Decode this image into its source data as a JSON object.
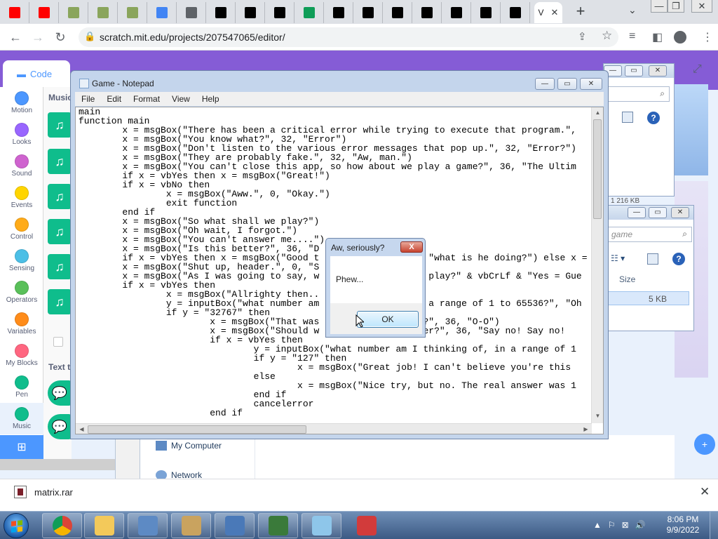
{
  "browser": {
    "tabs": [
      {
        "icon": "youtube-icon",
        "color": "#ff0000"
      },
      {
        "icon": "youtube-icon",
        "color": "#ff0000"
      },
      {
        "icon": "image-icon",
        "color": "#8aa55c"
      },
      {
        "icon": "image-icon",
        "color": "#8aa55c"
      },
      {
        "icon": "image-icon",
        "color": "#8aa55c"
      },
      {
        "icon": "google-icon",
        "color": "#4285f4"
      },
      {
        "icon": "globe-icon",
        "color": "#5f6368"
      },
      {
        "icon": "w-logo-icon",
        "color": "#000000"
      },
      {
        "icon": "w-logo-icon",
        "color": "#000000"
      },
      {
        "icon": "w-logo-icon",
        "color": "#000000"
      },
      {
        "icon": "sheets-icon",
        "color": "#0f9d58"
      },
      {
        "icon": "pillar-icon",
        "color": "#000000"
      },
      {
        "icon": "bolt-icon",
        "color": "#000000"
      },
      {
        "icon": "bolt-icon",
        "color": "#000000"
      },
      {
        "icon": "bolt-icon",
        "color": "#000000"
      },
      {
        "icon": "bolt-icon",
        "color": "#000000"
      },
      {
        "icon": "bolt-icon",
        "color": "#000000"
      },
      {
        "icon": "bolt-icon",
        "color": "#000000"
      }
    ],
    "active_tab_label": "V",
    "tab_close_label": "✕",
    "new_tab_label": "+",
    "tab_search_label": "⌄",
    "url": "scratch.mit.edu/projects/207547065/editor/"
  },
  "scratch": {
    "code_tab_label": "Code",
    "palette_title": "Music",
    "palette_title_2": "Text t",
    "categories": [
      {
        "label": "Motion",
        "color": "#4c97ff"
      },
      {
        "label": "Looks",
        "color": "#9966ff"
      },
      {
        "label": "Sound",
        "color": "#cf63cf"
      },
      {
        "label": "Events",
        "color": "#ffd500"
      },
      {
        "label": "Control",
        "color": "#ffab19"
      },
      {
        "label": "Sensing",
        "color": "#4cbfe6"
      },
      {
        "label": "Operators",
        "color": "#59c059"
      },
      {
        "label": "Variables",
        "color": "#ff8c1a"
      },
      {
        "label": "My Blocks",
        "color": "#ff6680"
      },
      {
        "label": "Pen",
        "color": "#0fbd8c"
      },
      {
        "label": "Music",
        "color": "#0fbd8c"
      }
    ]
  },
  "explorer": {
    "search_placeholder": "game",
    "size_header": "Size",
    "file_size": "5 KB",
    "partial_size_label": "1 216 KB",
    "nav_items": [
      "My Computer",
      "Network"
    ]
  },
  "notepad": {
    "title": "Game - Notepad",
    "menu": [
      "File",
      "Edit",
      "Format",
      "View",
      "Help"
    ],
    "lines": [
      "main",
      "function main",
      "        x = msgBox(\"There has been a critical error while trying to execute that program.\",",
      "        x = msgBox(\"You know what?\", 32, \"Error\")",
      "        x = msgBox(\"Don't listen to the various error messages that pop up.\", 32, \"Error?\")",
      "        x = msgBox(\"They are probably fake.\", 32, \"Aw, man.\")",
      "        x = msgBox(\"You can't close this app, so how about we play a game?\", 36, \"The Ultim",
      "        if x = vbYes then x = msgBox(\"Great!\")",
      "        if x = vbNo then",
      "                x = msgBox(\"Aww.\", 0, \"Okay.\")",
      "                exit function",
      "        end if",
      "        x = msgBox(\"So what shall we play?\")",
      "        x = msgBox(\"Oh wait, I forgot.\")",
      "        x = msgBox(\"You can't answer me....\")",
      "        x = msgBox(\"Is this better?\", 36, \"D",
      "        if x = vbYes then x = msgBox(\"Good t                    \"what is he doing?\") else x =",
      "        x = msgBox(\"Shut up, header.\", 0, \"S",
      "        x = msgBox(\"As I was going to say, w                    play?\" & vbCrLf & \"Yes = Gue",
      "        if x = vbYes then",
      "                x = msgBox(\"Allrighty then..",
      "                y = inputBox(\"what number am                    a range of 1 to 65536?\", \"Oh",
      "                if y = \"32767\" then",
      "                        x = msgBox(\"That was                 it?\", 36, \"O-O\")",
      "                        x = msgBox(\"Should w                 rder?\", 36, \"Say no! Say no!",
      "                        if x = vbYes then",
      "                                y = inputBox(\"what number am I thinking of, in a range of 1",
      "                                if y = \"127\" then",
      "                                        x = msgBox(\"Great job! I can't believe you're this",
      "                                else",
      "                                        x = msgBox(\"Nice try, but no. The real answer was 1",
      "                                end if",
      "                                cancelerror",
      "                        end if"
    ]
  },
  "dialog": {
    "title": "Aw, seriously?",
    "message": "Phew...",
    "ok_label": "OK",
    "close_label": "X"
  },
  "downloads": {
    "filename": "matrix.rar",
    "close_label": "✕"
  },
  "taskbar": {
    "apps": [
      {
        "name": "chrome",
        "color": "#db4437",
        "active": true
      },
      {
        "name": "file-explorer",
        "color": "#f3c95a",
        "active": true
      },
      {
        "name": "control-panel",
        "color": "#5d8ac4",
        "active": true
      },
      {
        "name": "paint",
        "color": "#c9a35f",
        "active": true
      },
      {
        "name": "network-program",
        "color": "#4a79b8",
        "active": true
      },
      {
        "name": "system-monitor",
        "color": "#3a7a3a",
        "active": true
      },
      {
        "name": "notepad",
        "color": "#8ec6ea",
        "active": true
      },
      {
        "name": "cube-app",
        "color": "#d23b3b",
        "active": false
      }
    ],
    "tray": [
      "▲",
      "⚐",
      "⊠",
      "🔊"
    ],
    "time": "8:06 PM",
    "date": "9/9/2022"
  },
  "colors": {
    "scratch_purple": "#855cd6",
    "scratch_blue": "#4c97ff",
    "music_green": "#0fbd8c",
    "dialog_close_red": "#c7432f"
  }
}
